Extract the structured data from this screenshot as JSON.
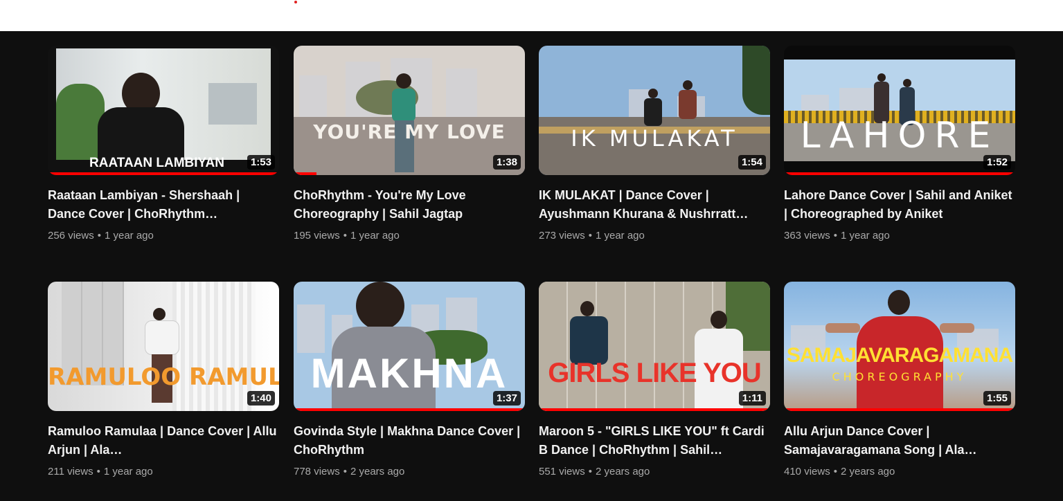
{
  "accent": "#ff0000",
  "background": "#0f0f0f",
  "videos": [
    {
      "overlay": "RAATAAN LAMBIYAN",
      "duration": "1:53",
      "title": "Raataan Lambiyan - Shershaah | Dance Cover | ChoRhythm…",
      "views": "256 views",
      "age": "1 year ago",
      "watched": 1.0
    },
    {
      "overlay": "YOU'RE MY LOVE",
      "duration": "1:38",
      "title": "ChoRhythm - You're My Love Choreography | Sahil Jagtap",
      "views": "195 views",
      "age": "1 year ago",
      "watched": 0.1
    },
    {
      "overlay": "IK MULAKAT",
      "duration": "1:54",
      "title": "IK MULAKAT | Dance Cover | Ayushmann Khurana & Nushrratt…",
      "views": "273 views",
      "age": "1 year ago",
      "watched": 0
    },
    {
      "overlay": "LAHORE",
      "duration": "1:52",
      "title": "Lahore Dance Cover | Sahil and Aniket | Choreographed by Aniket",
      "views": "363 views",
      "age": "1 year ago",
      "watched": 1.0
    },
    {
      "overlay": "RAMULOO RAMULAA",
      "duration": "1:40",
      "title": "Ramuloo Ramulaa | Dance Cover | Allu Arjun | Ala…",
      "views": "211 views",
      "age": "1 year ago",
      "watched": 0
    },
    {
      "overlay": "MAKHNA",
      "duration": "1:37",
      "title": "Govinda Style | Makhna Dance Cover | ChoRhythm",
      "views": "778 views",
      "age": "2 years ago",
      "watched": 1.0
    },
    {
      "overlay": "GIRLS LIKE YOU",
      "duration": "1:11",
      "title": "Maroon 5 - \"GIRLS LIKE YOU\" ft Cardi B Dance | ChoRhythm | Sahil…",
      "views": "551 views",
      "age": "2 years ago",
      "watched": 1.0
    },
    {
      "overlay": "SAMAJAVARAGAMANA",
      "overlay2": "CHOREOGRAPHY",
      "duration": "1:55",
      "title": "Allu Arjun Dance Cover | Samajavaragamana Song | Ala…",
      "views": "410 views",
      "age": "2 years ago",
      "watched": 1.0
    }
  ]
}
